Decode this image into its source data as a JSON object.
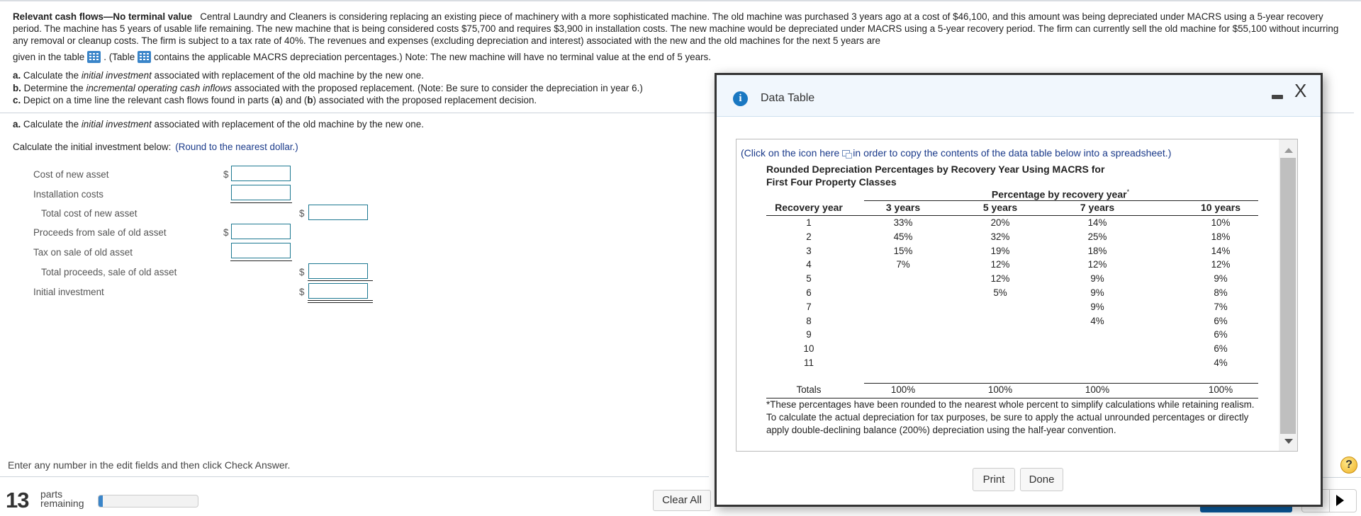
{
  "problem": {
    "title": "Relevant cash flows—No terminal value",
    "text": "Central Laundry and Cleaners is considering replacing an existing piece of machinery with a more sophisticated machine. The old machine was purchased 3 years ago at a cost of $46,100, and this amount was being depreciated under MACRS using a 5-year recovery period. The machine has 5 years of usable life remaining. The new machine that is being considered costs $75,700 and requires $3,900 in installation costs. The new machine would be depreciated under MACRS using a 5-year recovery period. The firm can currently sell the old machine for $55,100 without incurring any removal or cleanup costs. The firm is subject to a tax rate of 40%. The revenues and expenses (excluding depreciation and interest) associated with the new and the old machines for the next 5 years are",
    "given_prefix": "given in the table",
    "given_mid": ". (Table",
    "given_suffix": "contains the applicable MACRS depreciation percentages.) Note: The new machine will have no terminal value at the end of 5 years."
  },
  "parts": [
    {
      "letter": "a.",
      "pre": "Calculate the",
      "em": "initial investment",
      "post": "associated with replacement of the old machine by the new one."
    },
    {
      "letter": "b.",
      "pre": "Determine the",
      "em": "incremental operating cash inflows",
      "post": "associated with the proposed replacement. (Note: Be sure to consider the depreciation in year 6.)"
    },
    {
      "letter": "c.",
      "pre": "Depict on a time line the relevant cash flows found in parts (",
      "b1": "a",
      "mid": ") and (",
      "b2": "b",
      "post": ") associated with the proposed replacement decision."
    }
  ],
  "part_a": {
    "letter": "a.",
    "pre": "Calculate the",
    "em": "initial investment",
    "post": "associated with replacement of the old machine by the new one.",
    "intro": "Calculate the initial investment below:",
    "hint": "(Round to the nearest dollar.)",
    "currency": "$",
    "rows": [
      {
        "label": "Cost of new asset",
        "value": ""
      },
      {
        "label": "Installation costs",
        "value": ""
      },
      {
        "label": "Total cost of new asset",
        "value": ""
      },
      {
        "label": "Proceeds from sale of old asset",
        "value": ""
      },
      {
        "label": "Tax on sale of old asset",
        "value": ""
      },
      {
        "label": "Total proceeds, sale of old asset",
        "value": ""
      },
      {
        "label": "Initial investment",
        "value": ""
      }
    ]
  },
  "footer": {
    "instruction": "Enter any number in the edit fields and then click Check Answer.",
    "parts_count": "13",
    "parts_label_1": "parts",
    "parts_label_2": "remaining",
    "progress_fraction": 0.04,
    "clear_all": "Clear All",
    "help": "?"
  },
  "modal": {
    "title": "Data Table",
    "info_icon": "i",
    "close": "X",
    "copy_note_pre": "(Click on the icon here",
    "copy_note_post": "in order to copy the contents of the data table below into a spreadsheet.)",
    "table_title_1": "Rounded Depreciation Percentages by Recovery Year Using MACRS for",
    "table_title_2": "First Four Property Classes",
    "group_header": "Percentage by recovery year",
    "group_header_mark": "*",
    "columns": [
      "Recovery year",
      "3 years",
      "5 years",
      "7 years",
      "10 years"
    ],
    "rows": [
      [
        "1",
        "33%",
        "20%",
        "14%",
        "10%"
      ],
      [
        "2",
        "45%",
        "32%",
        "25%",
        "18%"
      ],
      [
        "3",
        "15%",
        "19%",
        "18%",
        "14%"
      ],
      [
        "4",
        "7%",
        "12%",
        "12%",
        "12%"
      ],
      [
        "5",
        "",
        "12%",
        "9%",
        "9%"
      ],
      [
        "6",
        "",
        "5%",
        "9%",
        "8%"
      ],
      [
        "7",
        "",
        "",
        "9%",
        "7%"
      ],
      [
        "8",
        "",
        "",
        "4%",
        "6%"
      ],
      [
        "9",
        "",
        "",
        "",
        "6%"
      ],
      [
        "10",
        "",
        "",
        "",
        "6%"
      ],
      [
        "11",
        "",
        "",
        "",
        "4%"
      ]
    ],
    "totals": [
      "Totals",
      "100%",
      "100%",
      "100%",
      "100%"
    ],
    "footnote": "*These percentages have been rounded to the nearest whole percent to simplify calculations while retaining realism. To calculate the actual depreciation for tax purposes, be sure to apply the actual unrounded percentages or directly apply double-declining balance (200%) depreciation using the half-year convention.",
    "print": "Print",
    "done": "Done"
  }
}
